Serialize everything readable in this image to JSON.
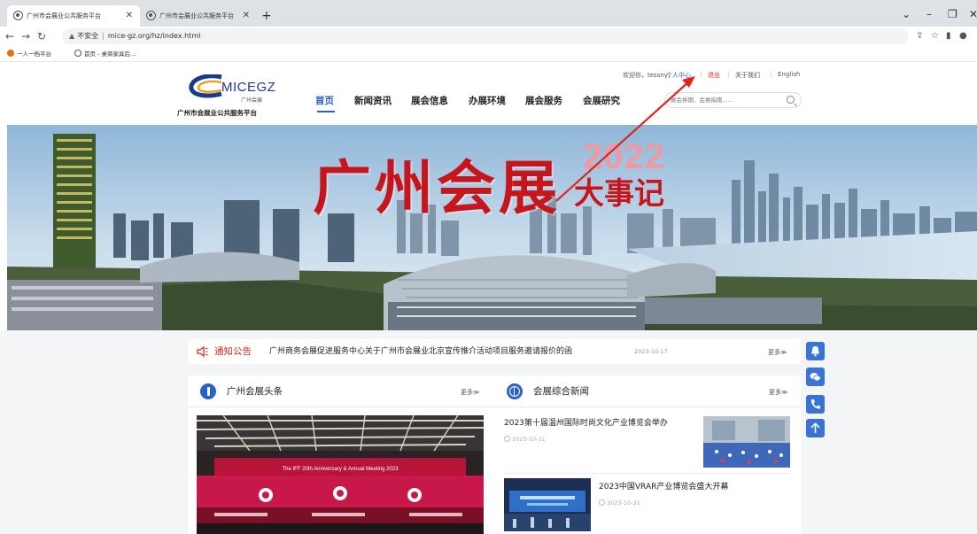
{
  "browser": {
    "tabs": [
      {
        "title": "广州市会展业公共服务平台",
        "active": true
      },
      {
        "title": "广州市会展业公共服务平台",
        "active": false
      }
    ],
    "new_tab": "+",
    "address": {
      "security": "不安全",
      "url": "mice-gz.org/hz/index.html"
    },
    "bookmarks": [
      {
        "label": "一人一档平台",
        "icon_color": "#e8710a"
      },
      {
        "label": "首页 - 桌商家具后...",
        "icon_color": "#555555"
      }
    ]
  },
  "site": {
    "logo": {
      "main_prefix": "MICE",
      "main_suffix": "GZ",
      "sub": "广州会展",
      "name": "广州市会展业公共服务平台"
    },
    "nav": [
      {
        "label": "首页",
        "active": true
      },
      {
        "label": "新闻资讯",
        "active": false
      },
      {
        "label": "展会信息",
        "active": false
      },
      {
        "label": "办展环境",
        "active": false
      },
      {
        "label": "展会服务",
        "active": false
      },
      {
        "label": "会展研究",
        "active": false
      }
    ],
    "top_links": {
      "welcome": "欢迎你，tessny，",
      "personal": "个人中心",
      "logout": "退出",
      "about": "关于我们",
      "english": "English",
      "separator": "|"
    },
    "search": {
      "placeholder": "展会排期、会展指南......"
    },
    "banner": {
      "title": "广州会展",
      "year": "2022",
      "subtitle": "大事记"
    },
    "notice": {
      "label": "通知公告",
      "text": "广州商务会展促进服务中心关于广州市会展业北京宣传推介活动项目服务邀请报价的函",
      "date": "2023-10-17",
      "more": "更多≫"
    },
    "headlines": {
      "title": "广州会展头条",
      "more": "更多≫",
      "image_caption": "The IFF 20th Anniversary & Annual Meeting 2023"
    },
    "news": {
      "title": "会展综合新闻",
      "more": "更多≫",
      "items": [
        {
          "title": "2023第十届温州国际时尚文化产业博览会举办",
          "date": "2023-10-31"
        },
        {
          "title": "2023中国VRAR产业博览会盛大开幕",
          "date": "2023-10-31"
        }
      ]
    }
  },
  "colors": {
    "accent": "#2a62c6",
    "brand_red": "#c8141b",
    "float_button": "#3a73d6"
  }
}
